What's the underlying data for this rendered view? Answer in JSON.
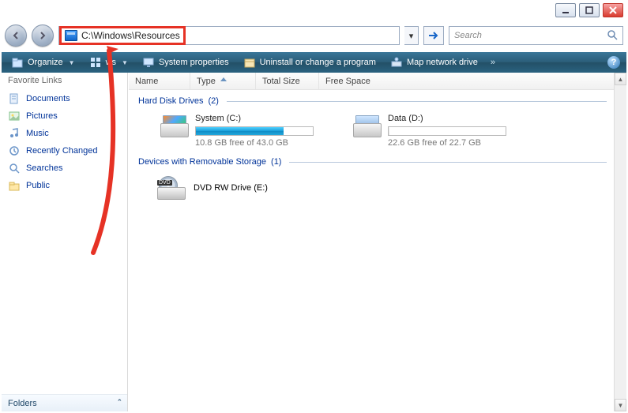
{
  "window_controls": {
    "min": "_",
    "max": "▢",
    "close": "✕"
  },
  "addressbar": {
    "path": "C:\\Windows\\Resources",
    "dropdown_glyph": "▾"
  },
  "go": {
    "glyph": "→"
  },
  "search": {
    "placeholder": "Search",
    "icon": "🔍"
  },
  "toolbar": {
    "organize": "Organize",
    "views": "ws",
    "system_properties": "System properties",
    "uninstall": "Uninstall or change a program",
    "map_drive": "Map network drive",
    "more": "»"
  },
  "sidebar": {
    "header": "Favorite Links",
    "items": [
      {
        "label": "Documents",
        "icon": "documents-icon"
      },
      {
        "label": "Pictures",
        "icon": "pictures-icon"
      },
      {
        "label": "Music",
        "icon": "music-icon"
      },
      {
        "label": "Recently Changed",
        "icon": "recent-icon"
      },
      {
        "label": "Searches",
        "icon": "searches-icon"
      },
      {
        "label": "Public",
        "icon": "public-folder-icon"
      }
    ],
    "folders_label": "Folders",
    "folders_chevron": "ˆ"
  },
  "columns": {
    "name": "Name",
    "type": "Type",
    "total": "Total Size",
    "free": "Free Space"
  },
  "groups": {
    "hdd": {
      "title": "Hard Disk Drives",
      "count": "(2)",
      "collapse_glyph": "ˆ",
      "drives": [
        {
          "name": "System (C:)",
          "free_text": "10.8 GB free of 43.0 GB",
          "fill_pct": 75,
          "low": false
        },
        {
          "name": "Data (D:)",
          "free_text": "22.6 GB free of 22.7 GB",
          "fill_pct": 1,
          "low": true
        }
      ]
    },
    "removable": {
      "title": "Devices with Removable Storage",
      "count": "(1)",
      "collapse_glyph": "ˆ",
      "items": [
        {
          "name": "DVD RW Drive (E:)",
          "badge": "DVD"
        }
      ]
    }
  }
}
